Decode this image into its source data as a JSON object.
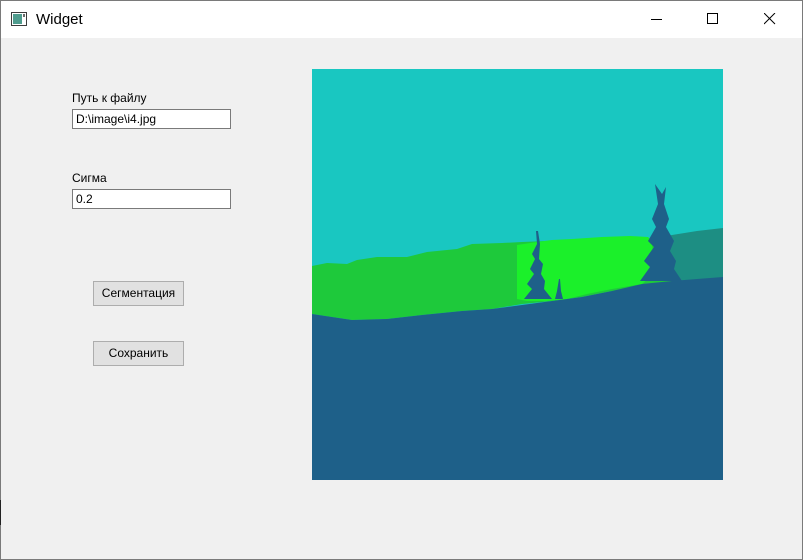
{
  "window": {
    "title": "Widget",
    "icons": {
      "app": "window-app-icon",
      "minimize": "minimize-icon",
      "maximize": "maximize-icon",
      "close": "close-icon"
    }
  },
  "form": {
    "path_label": "Путь к файлу",
    "path_value": "D:\\image\\i4.jpg",
    "sigma_label": "Сигма",
    "sigma_value": "0.2"
  },
  "buttons": {
    "segment_label": "Сегментация",
    "save_label": "Сохранить"
  },
  "segmented_image": {
    "colors": {
      "sky": "#19c7c1",
      "far_hills": "#1d8e83",
      "near_hills_dark": "#1ec93b",
      "near_hills_bright": "#1bf02a",
      "ground": "#1e6089",
      "trees": "#1e6089"
    }
  }
}
